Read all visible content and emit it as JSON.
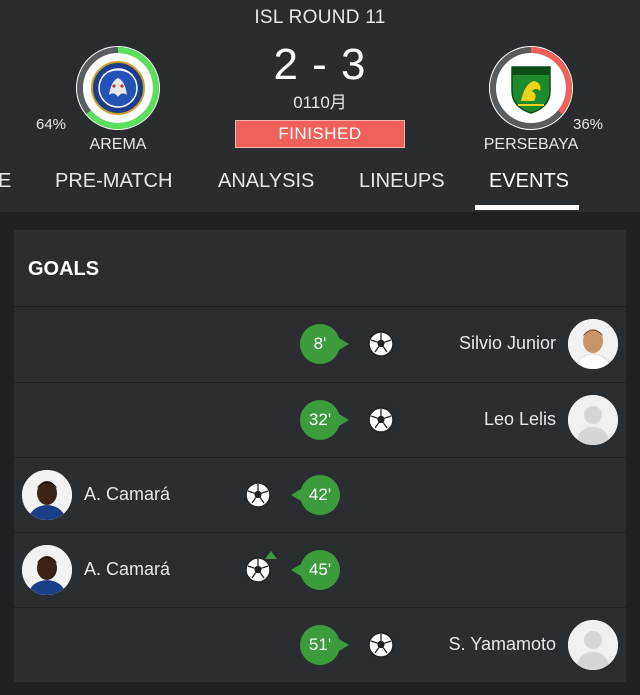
{
  "match": {
    "round": "ISL ROUND 11",
    "score": "2 - 3",
    "date": "0110月",
    "status": "FINISHED"
  },
  "home": {
    "name": "AREMA",
    "possession": "64%",
    "possession_value": 0.64,
    "ring_color": "#5ce05c",
    "crest_label": "AREMA FC"
  },
  "away": {
    "name": "PERSEBAYA",
    "possession": "36%",
    "possession_value": 0.36,
    "ring_color": "#f0615a",
    "crest_label": "PERSEBAYA"
  },
  "tabs": [
    "E",
    "PRE-MATCH",
    "ANALYSIS",
    "LINEUPS",
    "EVENTS"
  ],
  "active_tab": "EVENTS",
  "goals": {
    "title": "GOALS",
    "events": [
      {
        "minute": "8'",
        "player": "Silvio Junior",
        "team": "away",
        "icon": "soccer-ball-icon",
        "avatar": "player-photo"
      },
      {
        "minute": "32'",
        "player": "Leo Lelis",
        "team": "away",
        "icon": "soccer-ball-icon",
        "avatar": "placeholder-avatar"
      },
      {
        "minute": "42'",
        "player": "A. Camará",
        "team": "home",
        "icon": "soccer-ball-icon",
        "avatar": "player-photo"
      },
      {
        "minute": "45'",
        "player": "A. Camará",
        "team": "home",
        "icon": "soccer-ball-assist-icon",
        "avatar": "player-photo"
      },
      {
        "minute": "51'",
        "player": "S. Yamamoto",
        "team": "away",
        "icon": "soccer-ball-icon",
        "avatar": "placeholder-avatar"
      }
    ]
  },
  "colors": {
    "accent_green": "#3c9c3c",
    "finished_red": "#f0615a",
    "background": "#1e2124",
    "panel": "#2b2e31"
  }
}
